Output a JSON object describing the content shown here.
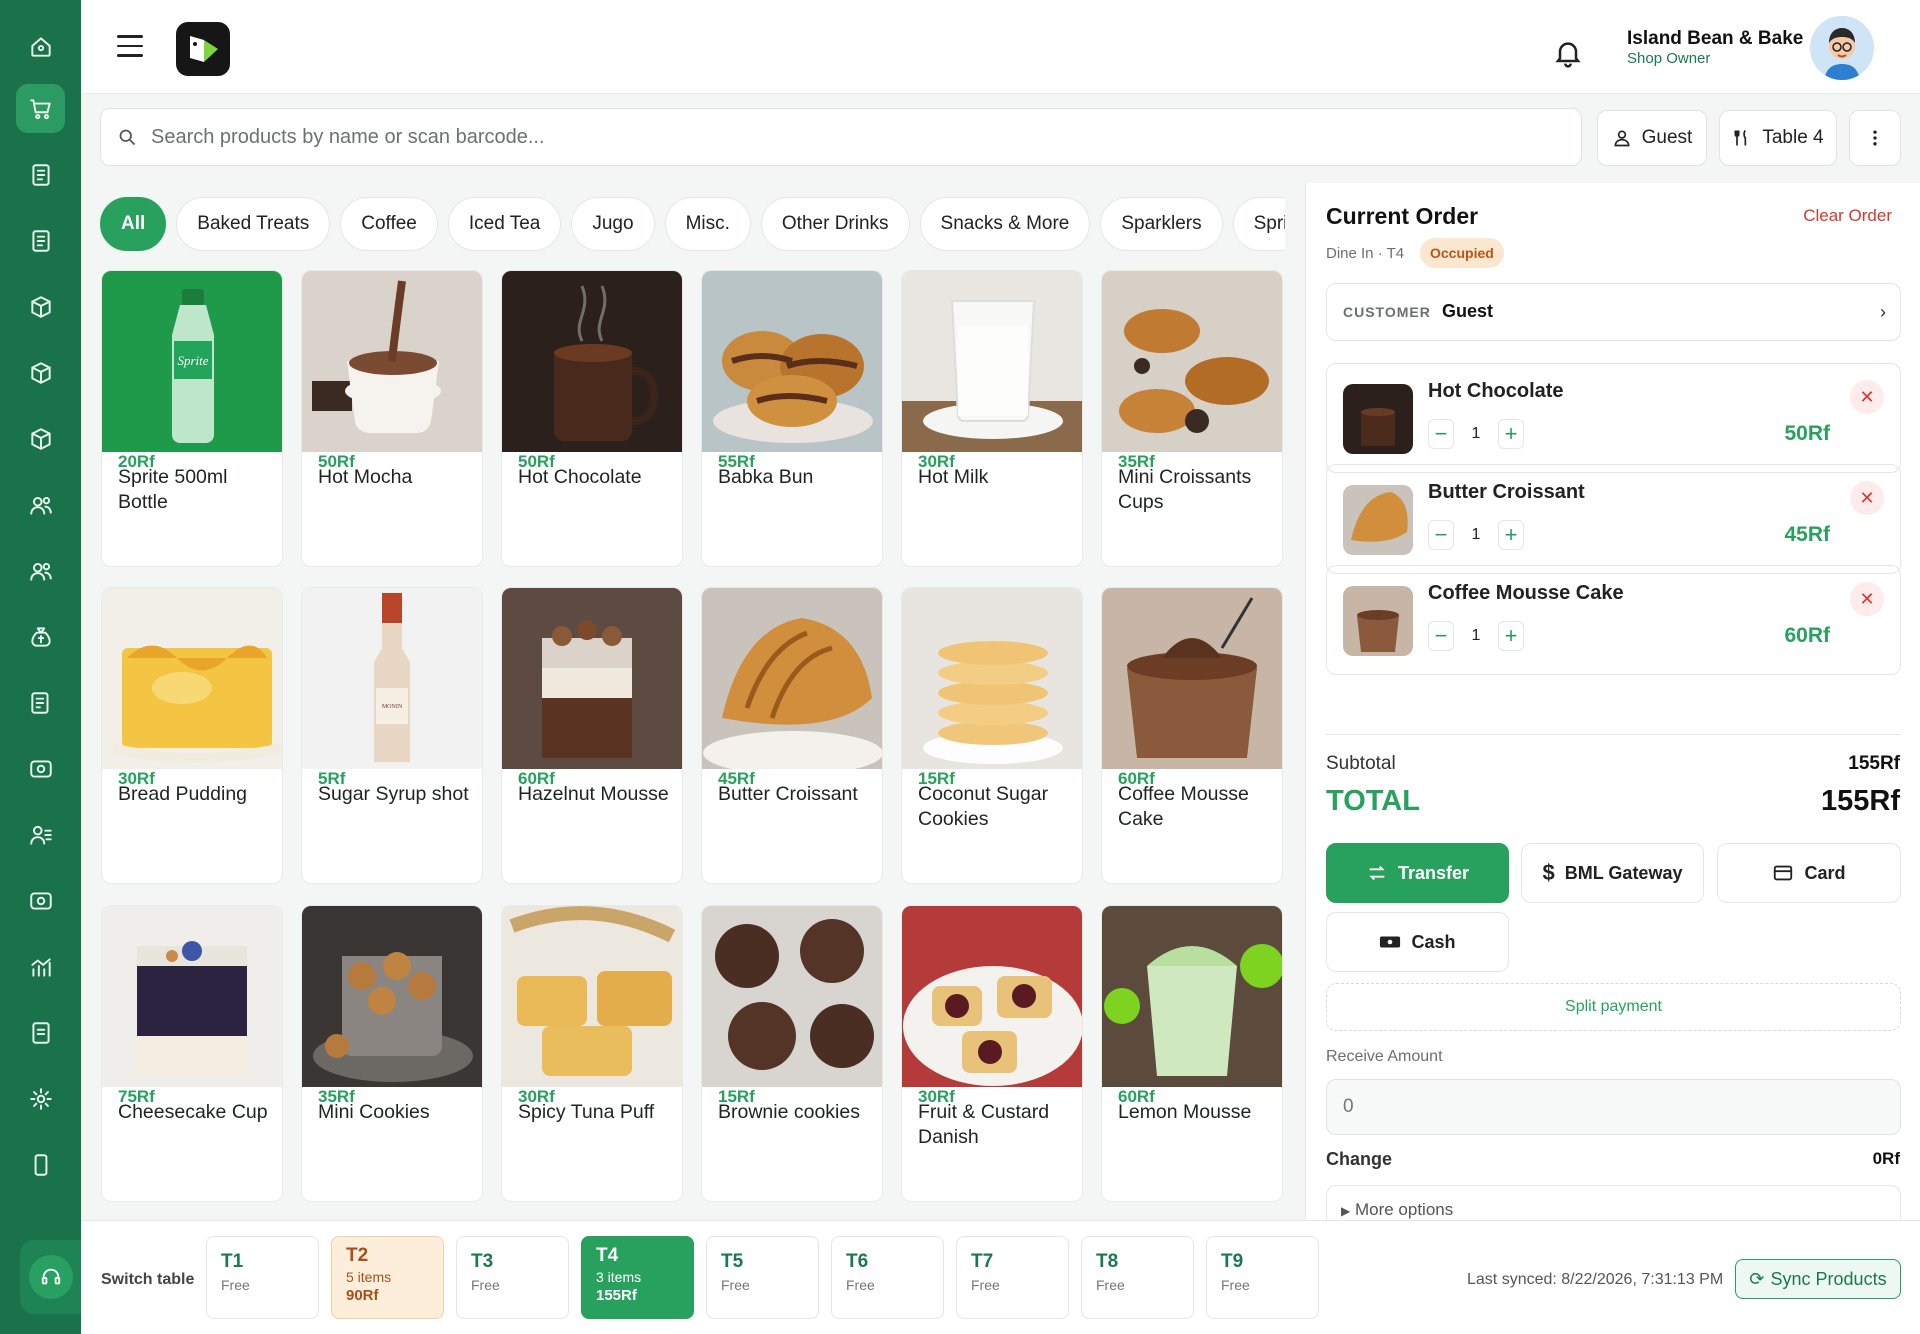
{
  "header": {
    "shop_name": "Island Bean & Bake",
    "shop_role": "Shop Owner"
  },
  "search": {
    "placeholder": "Search products by name or scan barcode..."
  },
  "toolbar": {
    "guest_label": "Guest",
    "table_label": "Table 4"
  },
  "categories": [
    "All",
    "Baked Treats",
    "Coffee",
    "Iced Tea",
    "Jugo",
    "Misc.",
    "Other Drinks",
    "Snacks & More",
    "Sparklers",
    "Spri"
  ],
  "products": [
    {
      "name": "Sprite 500ml Bottle",
      "price": "20Rf"
    },
    {
      "name": "Hot Mocha",
      "price": "50Rf"
    },
    {
      "name": "Hot Chocolate",
      "price": "50Rf"
    },
    {
      "name": "Babka Bun",
      "price": "55Rf"
    },
    {
      "name": "Hot Milk",
      "price": "30Rf"
    },
    {
      "name": "Mini Croissants Cups",
      "price": "35Rf"
    },
    {
      "name": "Bread Pudding",
      "price": "30Rf"
    },
    {
      "name": "Sugar Syrup shot",
      "price": "5Rf"
    },
    {
      "name": "Hazelnut Mousse",
      "price": "60Rf"
    },
    {
      "name": "Butter Croissant",
      "price": "45Rf"
    },
    {
      "name": "Coconut Sugar Cookies",
      "price": "15Rf"
    },
    {
      "name": "Coffee Mousse Cake",
      "price": "60Rf"
    },
    {
      "name": "Cheesecake Cup",
      "price": "75Rf"
    },
    {
      "name": "Mini Cookies",
      "price": "35Rf"
    },
    {
      "name": "Spicy Tuna Puff",
      "price": "30Rf"
    },
    {
      "name": "Brownie cookies",
      "price": "15Rf"
    },
    {
      "name": "Fruit & Custard Danish",
      "price": "30Rf"
    },
    {
      "name": "Lemon Mousse",
      "price": "60Rf"
    }
  ],
  "order": {
    "title": "Current Order",
    "clear_label": "Clear Order",
    "dine_info": "Dine In · T4",
    "status": "Occupied",
    "customer_label": "CUSTOMER",
    "customer_value": "Guest",
    "items": [
      {
        "name": "Hot Chocolate",
        "qty": "1",
        "price": "50Rf"
      },
      {
        "name": "Butter Croissant",
        "qty": "1",
        "price": "45Rf"
      },
      {
        "name": "Coffee Mousse Cake",
        "qty": "1",
        "price": "60Rf"
      }
    ],
    "subtotal_label": "Subtotal",
    "subtotal_value": "155Rf",
    "total_label": "TOTAL",
    "total_value": "155Rf",
    "payments": [
      "Transfer",
      "BML Gateway",
      "Card",
      "Cash"
    ],
    "split_label": "Split payment",
    "receive_label": "Receive Amount",
    "receive_value": "0",
    "change_label": "Change",
    "change_value": "0Rf",
    "more_label": "More options"
  },
  "bottom": {
    "switch_label": "Switch table",
    "tables": [
      {
        "name": "T1",
        "status": "Free"
      },
      {
        "name": "T2",
        "status": "5 items",
        "amount": "90Rf"
      },
      {
        "name": "T3",
        "status": "Free"
      },
      {
        "name": "T4",
        "status": "3 items",
        "amount": "155Rf"
      },
      {
        "name": "T5",
        "status": "Free"
      },
      {
        "name": "T6",
        "status": "Free"
      },
      {
        "name": "T7",
        "status": "Free"
      },
      {
        "name": "T8",
        "status": "Free"
      },
      {
        "name": "T9",
        "status": "Free"
      }
    ],
    "last_synced": "Last synced: 8/22/2026, 7:31:13 PM",
    "sync_label": "Sync Products"
  },
  "colors": {
    "sidebar": "#19724a",
    "accent": "#27a15d",
    "danger": "#d33a2f",
    "occupied_bg": "#fbe6cf"
  }
}
